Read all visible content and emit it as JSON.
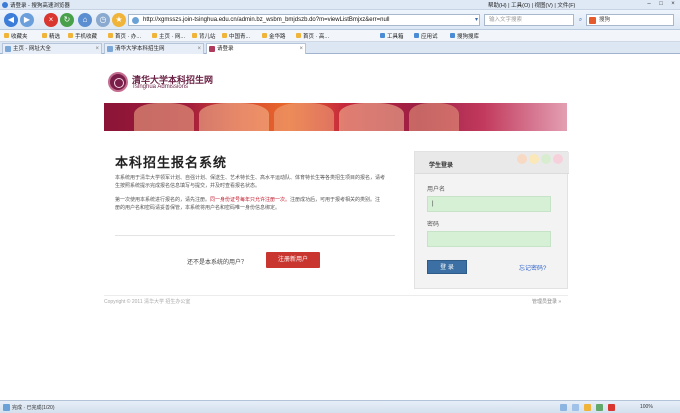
{
  "browser": {
    "window_title": "请登录 - 搜狗高速浏览器",
    "menu": "帮助(H) | 工具(O) | 视图(V) | 文件(F)",
    "url": "http://xgmsszs.join-tsinghua.edu.cn/admin.bz_wsbm_bmjdszb.do?m=viewListBmjxz&err=null",
    "search_placeholder": "输入文字搜索",
    "search2_value": "搜狗",
    "favorites": [
      {
        "label": "收藏夹"
      },
      {
        "label": "精选"
      },
      {
        "label": "手机收藏"
      },
      {
        "label": "首页 · 办..."
      },
      {
        "label": "主页 · 网..."
      },
      {
        "label": "背儿站"
      },
      {
        "label": "中国青..."
      },
      {
        "label": "金华路"
      },
      {
        "label": "首页 · 高..."
      }
    ],
    "tools": [
      {
        "label": "工具箱"
      },
      {
        "label": "应用试"
      },
      {
        "label": "搜狗搜库"
      }
    ],
    "tabs": [
      {
        "label": "主页 - 网址大全"
      },
      {
        "label": "清华大学本科招生网"
      },
      {
        "label": "请登录"
      }
    ],
    "status": {
      "left": "完成 · 已完成(1/20)",
      "right": "100%"
    }
  },
  "header": {
    "logo_cn": "清华大学本科招生网",
    "logo_en": "Tsinghua Admissions"
  },
  "main": {
    "title": "本科招生报名系统",
    "para1": "本系统用于清华大学领军计划、自强计划、保送生、艺术特长生、高水平运动队、体育特长生等各类招生项目的报名，请考生按照系统提示完成报名信息填写与提交，并及时查看报名状态。",
    "para2_a": "第一次使用本系统进行报名的，请先注册。",
    "para2_red": "同一身份证号每年只允许注册一次。",
    "para2_b": "注册成功后，可用于报考相关的类别。注册的用户名和密码请妥善保管，本系统将用户名和密码唯一身份信息绑定。",
    "register_question": "还不是本系统的用户？",
    "register_button": "注册新用户"
  },
  "login": {
    "title": "学生登录",
    "username_label": "用户名",
    "username_value": "|",
    "password_label": "密码",
    "password_value": "",
    "login_button": "登 录",
    "forgot_link": "忘记密码?"
  },
  "footer": {
    "copyright": "Copyright © 2011 清华大学  招生办公室",
    "admin_link": "管理员登录 »"
  },
  "colors": {
    "brand_purple": "#6b2245",
    "register_red": "#c9352f",
    "login_blue": "#3c6fa3",
    "field_green": "#d6f0d6"
  }
}
